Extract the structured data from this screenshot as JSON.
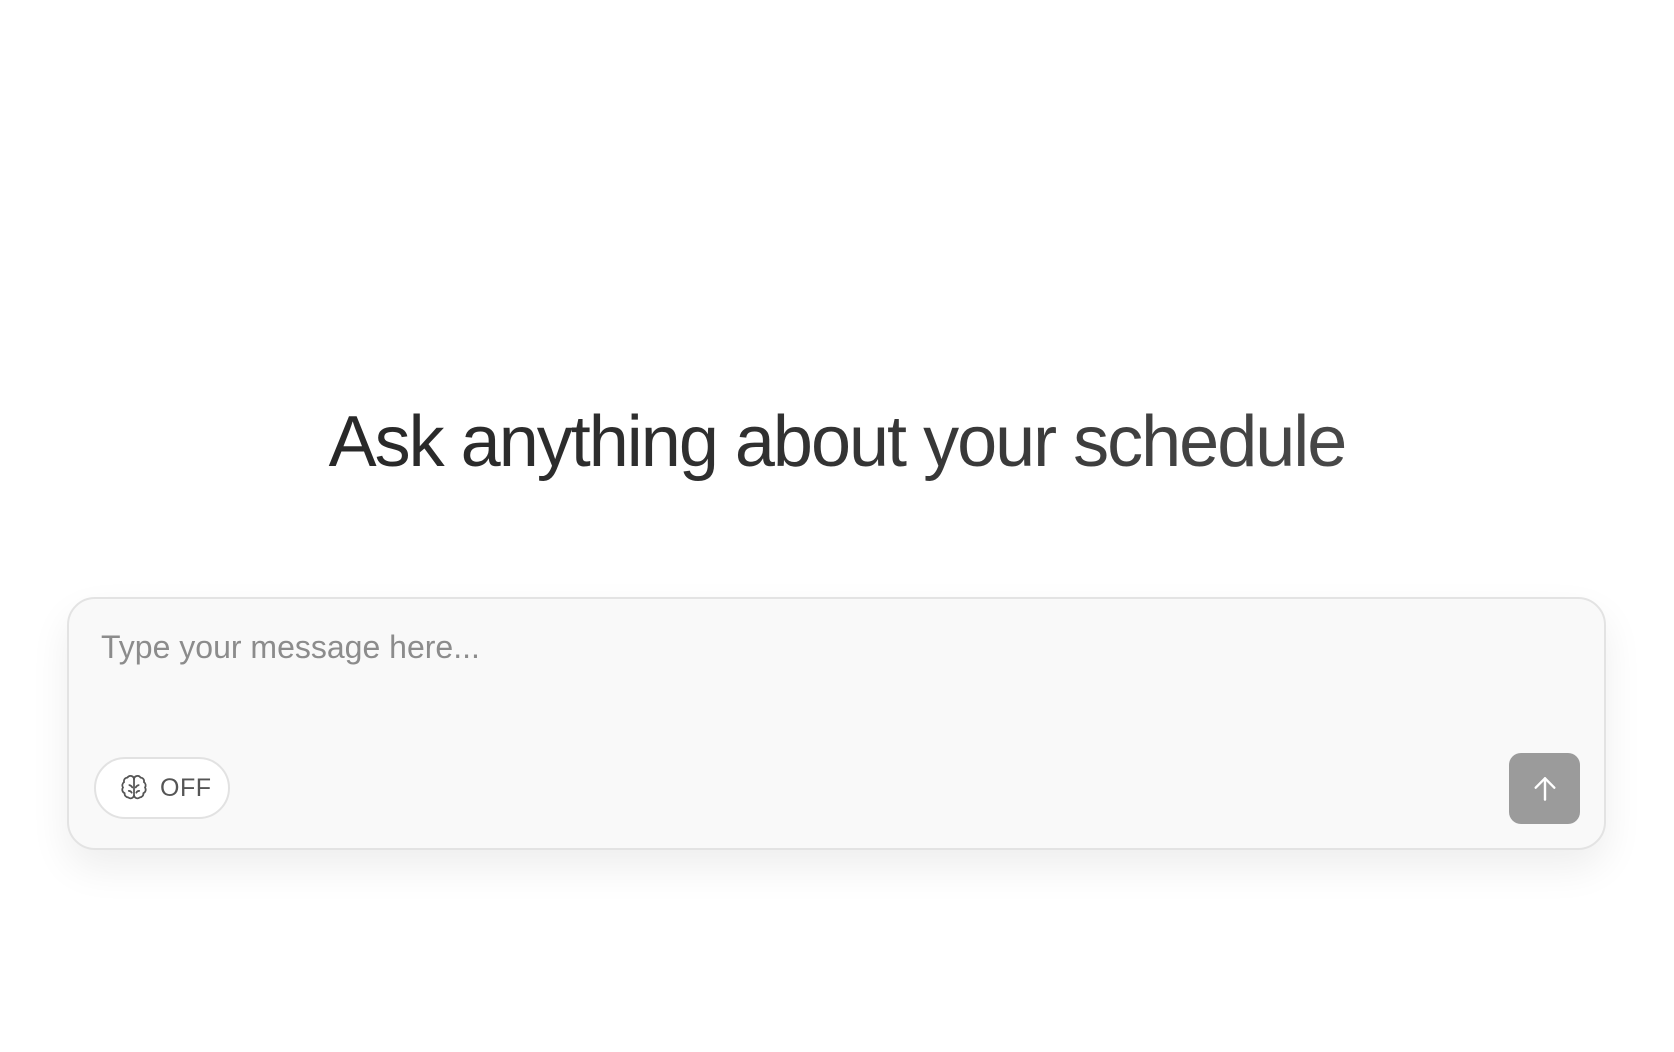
{
  "heading": {
    "title": "Ask anything about your schedule"
  },
  "composer": {
    "input_placeholder": "Type your message here...",
    "input_value": "",
    "think_toggle": {
      "icon": "brain-icon",
      "state_label": "OFF"
    },
    "send_button": {
      "icon": "arrow-up-icon",
      "color": "#9b9b9b",
      "enabled": false
    }
  }
}
